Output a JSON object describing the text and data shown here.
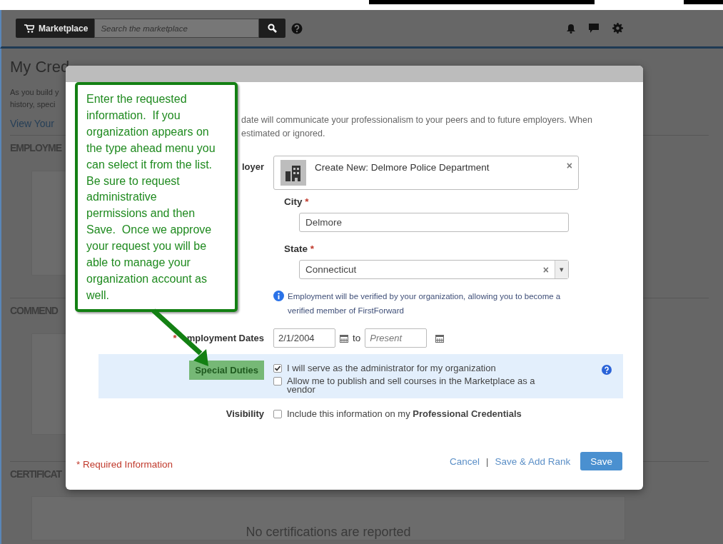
{
  "navbar": {
    "marketplace_label": "Marketplace",
    "search_placeholder": "Search the marketplace"
  },
  "page": {
    "title": "My Cred",
    "intro_lines": [
      "As you build y",
      "history, speci"
    ],
    "link": "View Your",
    "sections": [
      "EMPLOYME",
      "COMMEND",
      "CERTIFICAT"
    ],
    "empty_note": "No certifications are reported"
  },
  "modal": {
    "intro_lines": [
      "date will communicate your professionalism to your peers and to future employers. When",
      "estimated or ignored."
    ],
    "employer": {
      "label": "loyer",
      "value": "Create New: Delmore Police Department",
      "clear": "×"
    },
    "city": {
      "label": "City",
      "required_mark": "*",
      "value": "Delmore"
    },
    "state": {
      "label": "State",
      "required_mark": "*",
      "value": "Connecticut",
      "clear": "×",
      "caret": "▾"
    },
    "info": "Employment will be verified by your organization, allowing you to become a verified member of FirstForward",
    "dates": {
      "label": "mployment Dates",
      "required_mark": "*",
      "start": "2/1/2004",
      "joiner": "to",
      "end_placeholder": "Present"
    },
    "special_duties": {
      "label": "Special Duties",
      "highlighted": true,
      "options": [
        {
          "label": "I will serve as the administrator for my organization",
          "checked": true
        },
        {
          "label": "Allow me to publish and sell courses in the Marketplace as a vendor",
          "checked": false
        }
      ]
    },
    "visibility": {
      "label": "Visibility",
      "option": {
        "label": "Include this information on my **Professional Credentials**",
        "checked": false
      }
    },
    "required_note": "* Required Information",
    "actions": [
      {
        "kind": "link",
        "label": "Cancel"
      },
      {
        "kind": "separator",
        "label": "|"
      },
      {
        "kind": "link",
        "label": "Save & Add Rank"
      },
      {
        "kind": "button",
        "label": "Save"
      }
    ]
  },
  "callout": {
    "text": "Enter the requested information.  If you organization appears on the type ahead menu you can select it from the list.  Be sure to request administrative permissions and then Save.  Once we approve your request you will be able to manage your organization account as well."
  }
}
